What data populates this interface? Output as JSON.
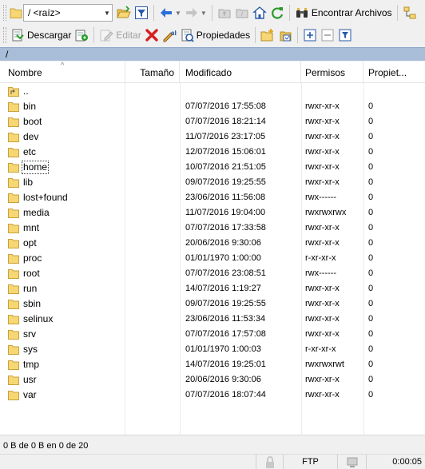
{
  "toolbar1": {
    "path_combo_value": "/ <raíz>",
    "find_files_label": "Encontrar Archivos"
  },
  "toolbar2": {
    "download_label": "Descargar",
    "edit_label": "Editar",
    "properties_label": "Propiedades"
  },
  "current_path": "/",
  "columns": {
    "name": "Nombre",
    "size": "Tamaño",
    "modified": "Modificado",
    "permissions": "Permisos",
    "owner": "Propiet..."
  },
  "parent_dir": "..",
  "files": [
    {
      "name": "bin",
      "modified": "07/07/2016 17:55:08",
      "permissions": "rwxr-xr-x",
      "owner": "0"
    },
    {
      "name": "boot",
      "modified": "07/07/2016 18:21:14",
      "permissions": "rwxr-xr-x",
      "owner": "0"
    },
    {
      "name": "dev",
      "modified": "11/07/2016 23:17:05",
      "permissions": "rwxr-xr-x",
      "owner": "0"
    },
    {
      "name": "etc",
      "modified": "12/07/2016 15:06:01",
      "permissions": "rwxr-xr-x",
      "owner": "0"
    },
    {
      "name": "home",
      "modified": "10/07/2016 21:51:05",
      "permissions": "rwxr-xr-x",
      "owner": "0"
    },
    {
      "name": "lib",
      "modified": "09/07/2016 19:25:55",
      "permissions": "rwxr-xr-x",
      "owner": "0"
    },
    {
      "name": "lost+found",
      "modified": "23/06/2016 11:56:08",
      "permissions": "rwx------",
      "owner": "0"
    },
    {
      "name": "media",
      "modified": "11/07/2016 19:04:00",
      "permissions": "rwxrwxrwx",
      "owner": "0"
    },
    {
      "name": "mnt",
      "modified": "07/07/2016 17:33:58",
      "permissions": "rwxr-xr-x",
      "owner": "0"
    },
    {
      "name": "opt",
      "modified": "20/06/2016 9:30:06",
      "permissions": "rwxr-xr-x",
      "owner": "0"
    },
    {
      "name": "proc",
      "modified": "01/01/1970 1:00:00",
      "permissions": "r-xr-xr-x",
      "owner": "0"
    },
    {
      "name": "root",
      "modified": "07/07/2016 23:08:51",
      "permissions": "rwx------",
      "owner": "0"
    },
    {
      "name": "run",
      "modified": "14/07/2016 1:19:27",
      "permissions": "rwxr-xr-x",
      "owner": "0"
    },
    {
      "name": "sbin",
      "modified": "09/07/2016 19:25:55",
      "permissions": "rwxr-xr-x",
      "owner": "0"
    },
    {
      "name": "selinux",
      "modified": "23/06/2016 11:53:34",
      "permissions": "rwxr-xr-x",
      "owner": "0"
    },
    {
      "name": "srv",
      "modified": "07/07/2016 17:57:08",
      "permissions": "rwxr-xr-x",
      "owner": "0"
    },
    {
      "name": "sys",
      "modified": "01/01/1970 1:00:03",
      "permissions": "r-xr-xr-x",
      "owner": "0"
    },
    {
      "name": "tmp",
      "modified": "14/07/2016 19:25:01",
      "permissions": "rwxrwxrwt",
      "owner": "0"
    },
    {
      "name": "usr",
      "modified": "20/06/2016 9:30:06",
      "permissions": "rwxr-xr-x",
      "owner": "0"
    },
    {
      "name": "var",
      "modified": "07/07/2016 18:07:44",
      "permissions": "rwxr-xr-x",
      "owner": "0"
    }
  ],
  "focused_index": 4,
  "status": {
    "summary": "0 B de 0 B en 0 de 20",
    "protocol": "FTP",
    "elapsed": "0:00:05"
  },
  "colors": {
    "folder": "#f7d674",
    "path_bar": "#a7bdd8",
    "delete": "#d81e1e",
    "nav_blue": "#2a6fd6",
    "refresh_green": "#2a9a2a"
  }
}
